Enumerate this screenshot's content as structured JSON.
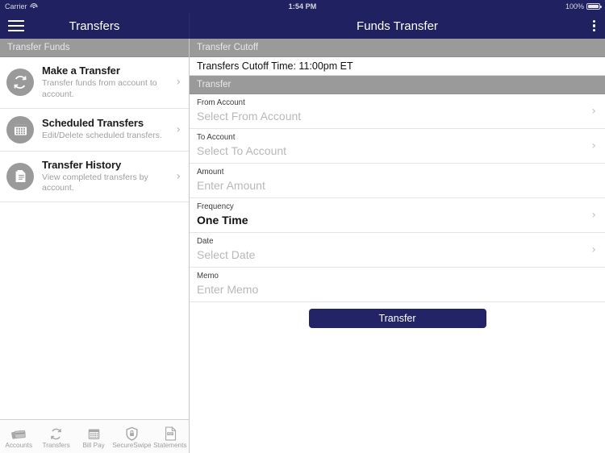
{
  "status_bar": {
    "carrier": "Carrier",
    "wifi_icon": "wifi-icon",
    "time": "1:54 PM",
    "battery_percent": "100%",
    "battery_icon": "battery-full-icon"
  },
  "nav": {
    "menu_icon": "hamburger-menu-icon",
    "left_title": "Transfers",
    "right_title": "Funds Transfer",
    "overflow_icon": "kebab-menu-icon"
  },
  "sidebar": {
    "section_header": "Transfer Funds",
    "items": [
      {
        "title": "Make a Transfer",
        "subtitle": "Transfer funds from account to account.",
        "icon": "refresh-circle-icon",
        "chevron": "chevron-right-icon"
      },
      {
        "title": "Scheduled Transfers",
        "subtitle": "Edit/Delete scheduled transfers.",
        "icon": "calendar-icon",
        "chevron": "chevron-right-icon"
      },
      {
        "title": "Transfer History",
        "subtitle": "View completed transfers by account.",
        "icon": "document-list-icon",
        "chevron": "chevron-right-icon"
      }
    ]
  },
  "tabbar": {
    "tabs": [
      {
        "label": "Accounts",
        "icon": "cards-icon"
      },
      {
        "label": "Transfers",
        "icon": "refresh-icon"
      },
      {
        "label": "Bill Pay",
        "icon": "calendar-icon"
      },
      {
        "label": "SecureSwipe",
        "icon": "shield-lock-icon"
      },
      {
        "label": "Statements",
        "icon": "pdf-document-icon"
      }
    ]
  },
  "detail": {
    "cutoff_header": "Transfer Cutoff",
    "cutoff_text": "Transfers Cutoff Time: 11:00pm ET",
    "transfer_header": "Transfer",
    "fields": [
      {
        "label": "From Account",
        "value": "Select From Account",
        "filled": false,
        "chevron": true
      },
      {
        "label": "To Account",
        "value": "Select To Account",
        "filled": false,
        "chevron": true
      },
      {
        "label": "Amount",
        "value": "Enter Amount",
        "filled": false,
        "chevron": false
      },
      {
        "label": "Frequency",
        "value": "One Time",
        "filled": true,
        "chevron": true
      },
      {
        "label": "Date",
        "value": "Select Date",
        "filled": false,
        "chevron": true
      },
      {
        "label": "Memo",
        "value": "Enter Memo",
        "filled": false,
        "chevron": false
      }
    ],
    "submit_label": "Transfer"
  },
  "colors": {
    "navbar": "#1f2160",
    "section_header": "#9a9a9a",
    "primary_button": "#232468",
    "icon_circle": "#9a9a9a",
    "placeholder_text": "#b8b8b8"
  }
}
